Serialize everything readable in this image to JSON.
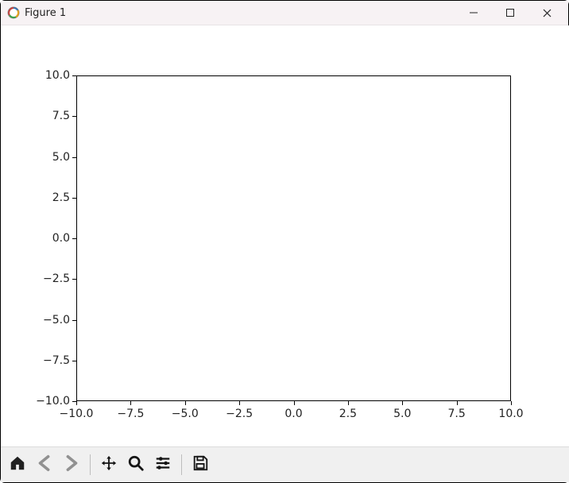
{
  "window": {
    "title": "Figure 1"
  },
  "chart_data": {
    "type": "line",
    "title": "",
    "xlabel": "",
    "ylabel": "",
    "xlim": [
      -10.0,
      10.0
    ],
    "ylim": [
      -10.0,
      10.0
    ],
    "xticks": [
      -10.0,
      -7.5,
      -5.0,
      -2.5,
      0.0,
      2.5,
      5.0,
      7.5,
      10.0
    ],
    "yticks": [
      -10.0,
      -7.5,
      -5.0,
      -2.5,
      0.0,
      2.5,
      5.0,
      7.5,
      10.0
    ],
    "xtick_labels": [
      "−10.0",
      "−7.5",
      "−5.0",
      "−2.5",
      "0.0",
      "2.5",
      "5.0",
      "7.5",
      "10.0"
    ],
    "ytick_labels": [
      "−10.0",
      "−7.5",
      "−5.0",
      "−2.5",
      "0.0",
      "2.5",
      "5.0",
      "7.5",
      "10.0"
    ],
    "grid": false,
    "legend": false,
    "series": []
  },
  "toolbar": {
    "home": "Home",
    "back": "Back",
    "forward": "Forward",
    "pan": "Pan",
    "zoom": "Zoom",
    "configure": "Configure subplots",
    "save": "Save the figure"
  }
}
